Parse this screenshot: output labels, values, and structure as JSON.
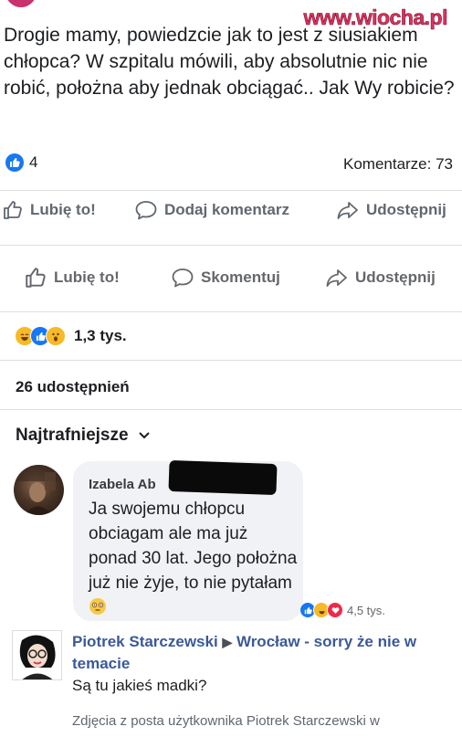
{
  "watermark": "www.wiocha.pl",
  "post": {
    "text": "Drogie mamy, powiedzcie jak to jest z siusiakiem chłopca? W szpitalu mówili, aby absolutnie nic nie robić, położna aby jednak obciągać.. Jak Wy robicie?",
    "likes": "4",
    "comments": "Komentarze: 73"
  },
  "actions_a": {
    "like": "Lubię to!",
    "comment": "Dodaj komentarz",
    "share": "Udostępnij"
  },
  "actions_b": {
    "like": "Lubię to!",
    "comment": "Skomentuj",
    "share": "Udostępnij"
  },
  "reactions_count": "1,3 tys.",
  "shares": "26 udostępnień",
  "sort_label": "Najtrafniejsze",
  "comment": {
    "author": "Izabela Ab",
    "text": "Ja swojemu chłopcu obciagam ale ma już ponad 30 lat. Jego położna już nie żyje, to nie pytałam",
    "reactions": "4,5 tys."
  },
  "share_post": {
    "author": "Piotrek Starczewski",
    "arrow": "▶",
    "target": "Wrocław - sorry że nie w temacie",
    "text": "Są tu jakieś madki?",
    "caption": "Zdjęcia z posta użytkownika Piotrek Starczewski w"
  },
  "colors": {
    "accent": "#1877f2",
    "link": "#3b5998",
    "watermark": "#d8345f"
  }
}
